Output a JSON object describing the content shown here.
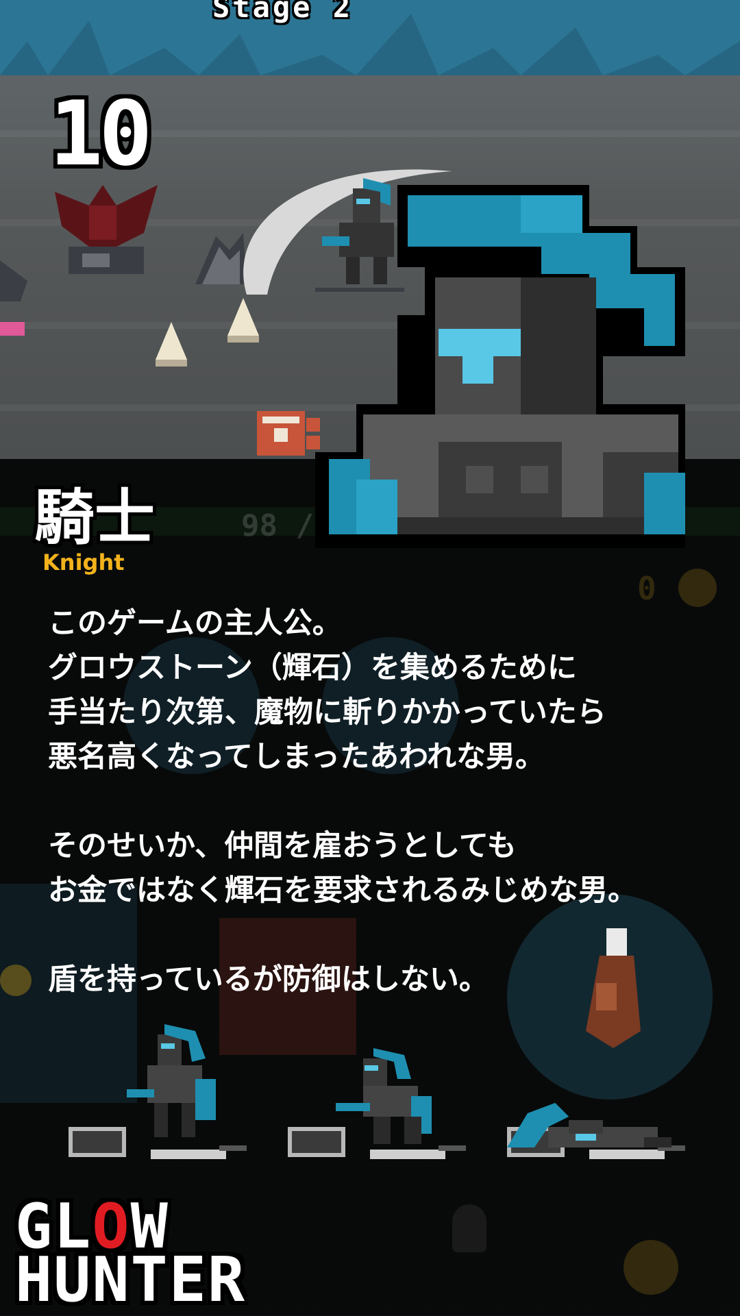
{
  "stage": {
    "label": "Stage 2",
    "combo": "10"
  },
  "hud": {
    "hp_text": "98 / 9",
    "coins": "0",
    "count": "10"
  },
  "character": {
    "name_jp": "騎士",
    "name_en": "Knight",
    "description": [
      "このゲームの主人公。",
      "グロウストーン（輝石）を集めるために",
      "手当たり次第、魔物に斬りかかっていたら",
      "悪名高くなってしまったあわれな男。",
      "",
      "そのせいか、仲間を雇おうとしても",
      "お金ではなく輝石を要求されるみじめな男。",
      "",
      "盾を持っているが防御はしない。"
    ]
  },
  "logo": {
    "line1_a": "GL",
    "line1_o": "O",
    "line1_b": "W",
    "line2": "HUNTER"
  },
  "colors": {
    "accent_blue": "#1e8fb0",
    "light_blue": "#59c8e6",
    "name_en": "#f2b21c",
    "logo_red": "#e01c22"
  }
}
